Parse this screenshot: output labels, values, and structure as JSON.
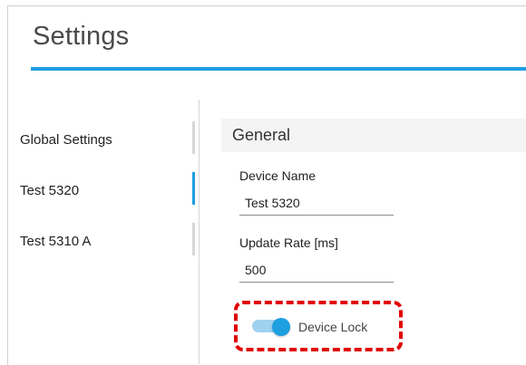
{
  "header": {
    "title": "Settings"
  },
  "colors": {
    "accent": "#1e9fe0",
    "highlight": "#e10000"
  },
  "sidebar": {
    "items": [
      {
        "label": "Global Settings",
        "active": false
      },
      {
        "label": "Test 5320",
        "active": true
      },
      {
        "label": "Test 5310 A",
        "active": false
      }
    ]
  },
  "main": {
    "section_title": "General",
    "fields": {
      "device_name": {
        "label": "Device Name",
        "value": "Test 5320"
      },
      "update_rate": {
        "label": "Update Rate [ms]",
        "value": "500"
      }
    },
    "device_lock": {
      "label": "Device Lock",
      "enabled": true
    }
  }
}
